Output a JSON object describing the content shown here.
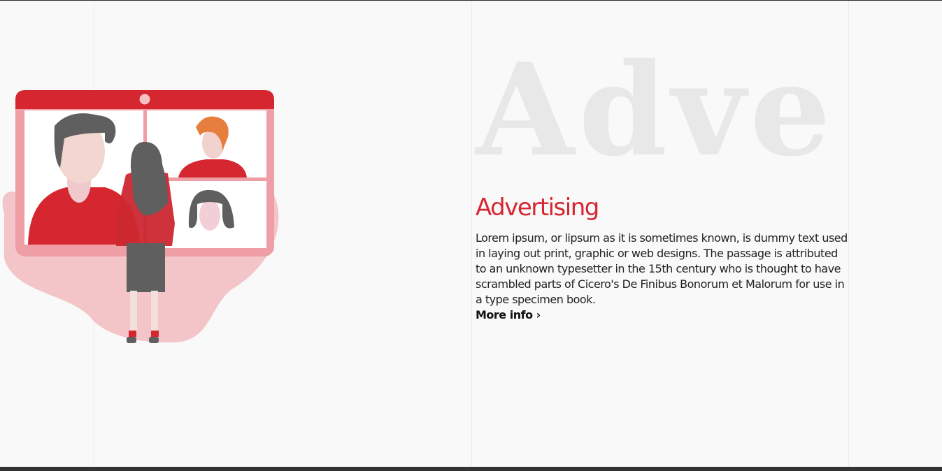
{
  "section": {
    "watermark": "Adve",
    "heading": "Advertising",
    "body": "Lorem ipsum, or lipsum as it is sometimes known, is dummy text used in laying out print, graphic or web designs. The passage is attributed to an unknown typesetter in the 15th century who is thought to have scrambled parts of Cicero's De Finibus Bonorum et Malorum for use in a type specimen book.",
    "more_link": "More info ›"
  },
  "colors": {
    "accent": "#d62731",
    "background": "#f9f9fa",
    "watermark": "#e8e8e8",
    "text": "#222222"
  },
  "illustration": {
    "subject": "video-call-illustration"
  }
}
